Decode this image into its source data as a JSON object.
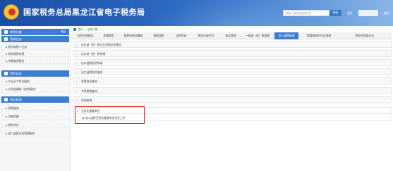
{
  "header": {
    "site_title": "国家税务总局黑龙江省电子税务局",
    "search_placeholder": "请输入搜索信息的内容",
    "search_button": "搜索",
    "user_label": "您好",
    "exit_label": "| 退出"
  },
  "breadcrumb": {
    "home": "首页",
    "sep": ">",
    "current": "全部功能"
  },
  "sidebar": {
    "sections": [
      {
        "label": "常用功能",
        "more": "收起"
      },
      {
        "label": "套餐业务"
      },
      {
        "label": "特色业务"
      },
      {
        "label": "税务查询"
      }
    ],
    "items": [
      "新办纳税人业务",
      "财务报表申报",
      "专题套餐服务",
      "大企业个性化服务",
      "公积金缴纳（综合服务）",
      "政策速递",
      "涉税提醒",
      "我的待办",
      "出口退税业务管理服务"
    ]
  },
  "tabs": [
    "综合信息报告",
    "发票使用",
    "税费申报及缴纳",
    "税收减免",
    "证明开具",
    "税务行政许可",
    "核定管理",
    "一般退（抵）税管理",
    "出口退税管理",
    "增值税抵扣凭证管理",
    "税务代保管业务"
  ],
  "active_tab_index": 8,
  "accordion": [
    "出口退（免）税企业资格信息报告",
    "出口退（免）税申报",
    "出口退税证明申请",
    "出口退税相关服务",
    "发票信息查询",
    "专用税票查询",
    "其他查询",
    "无纸化备案单证"
  ],
  "accordion_open_index": 7,
  "accordion_sub_item": "出口退税无纸化备案单证信息上传",
  "colors": {
    "header_start": "#1a4da3",
    "accent": "#3d7dd1",
    "highlight": "#e02020"
  }
}
